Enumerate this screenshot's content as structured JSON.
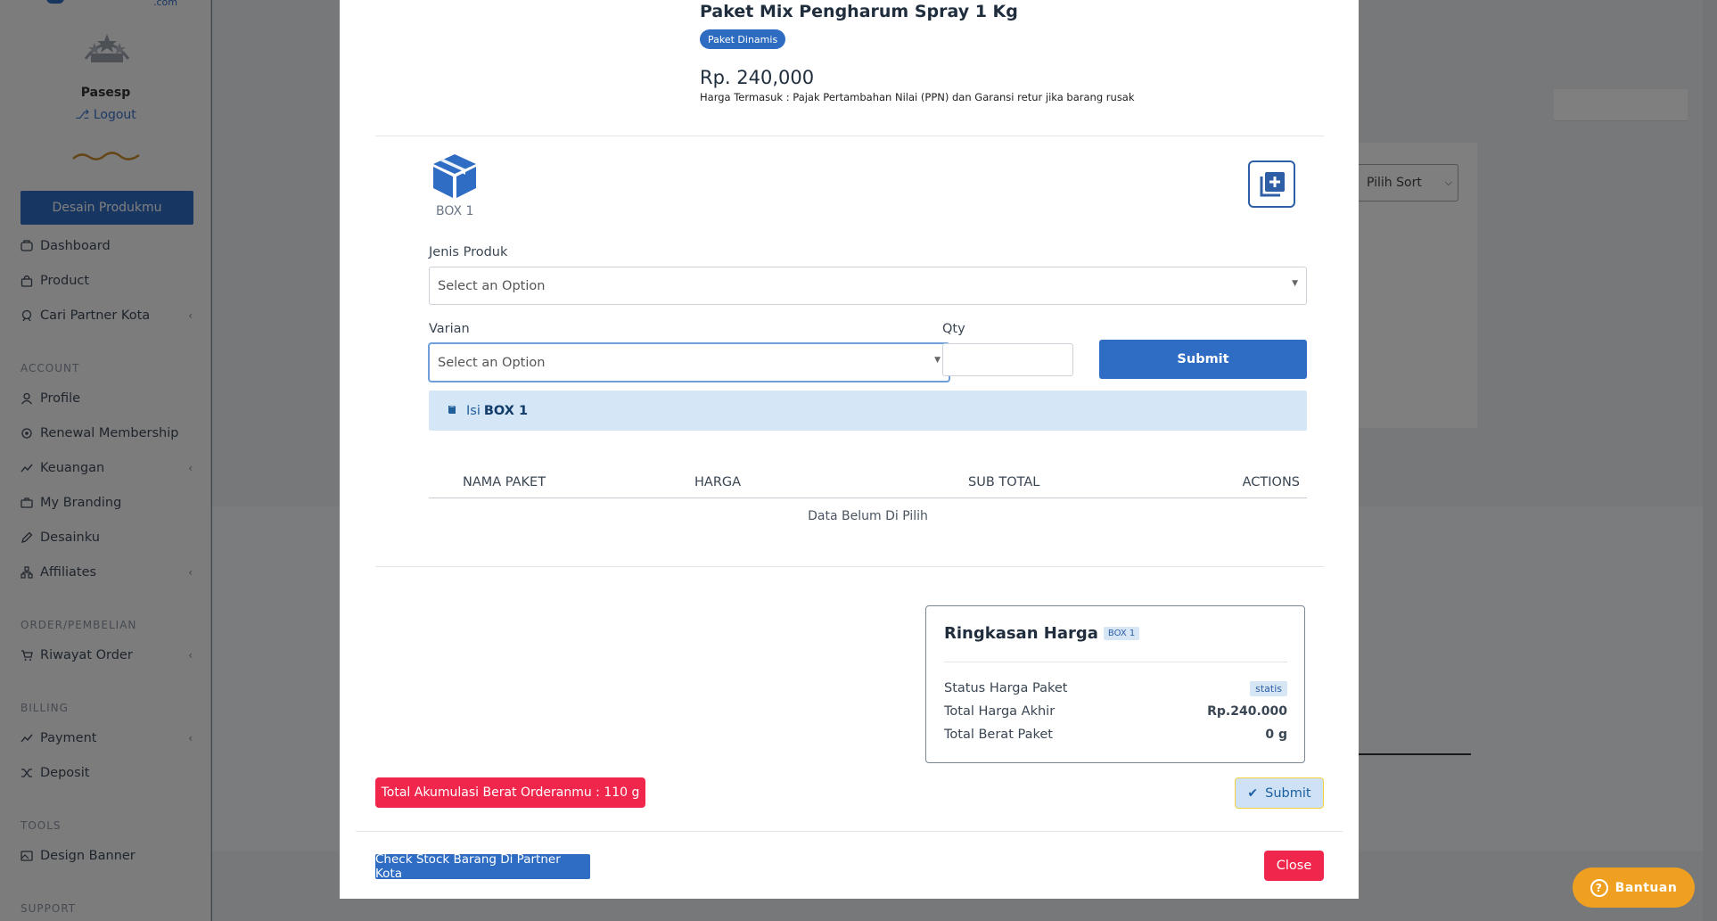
{
  "sidebar": {
    "logo_suffix": ".com",
    "user_name": "Pasesp",
    "logout_label": "Logout",
    "design_button": "Desain Produkmu",
    "items_main": [
      {
        "label": "Dashboard",
        "icon": "dashboard-icon"
      },
      {
        "label": "Product",
        "icon": "bag-icon"
      },
      {
        "label": "Cari Partner Kota",
        "icon": "search-partner-icon",
        "chevron": true
      }
    ],
    "account_heading": "ACCOUNT",
    "items_account": [
      {
        "label": "Profile",
        "icon": "user-icon"
      },
      {
        "label": "Renewal Membership",
        "icon": "refresh-icon"
      },
      {
        "label": "Keuangan",
        "icon": "chart-line-icon",
        "chevron": true
      },
      {
        "label": "My Branding",
        "icon": "briefcase-icon"
      },
      {
        "label": "Desainku",
        "icon": "pencil-icon"
      },
      {
        "label": "Affiliates",
        "icon": "network-icon",
        "chevron": true
      }
    ],
    "order_heading": "ORDER/PEMBELIAN",
    "items_order": [
      {
        "label": "Riwayat Order",
        "icon": "cart-icon",
        "chevron": true
      }
    ],
    "billing_heading": "BILLING",
    "items_billing": [
      {
        "label": "Payment",
        "icon": "chart-line-icon",
        "chevron": true
      },
      {
        "label": "Deposit",
        "icon": "shuffle-icon"
      }
    ],
    "tools_heading": "TOOLS",
    "items_tools": [
      {
        "label": "Design Banner",
        "icon": "image-icon"
      }
    ],
    "support_heading": "SUPPORT"
  },
  "background": {
    "sort_select": "Pilih Sort"
  },
  "modal": {
    "product_title": "Paket Mix Pengharum Spray 1 Kg",
    "type_badge": "Paket Dinamis",
    "price": "Rp. 240,000",
    "price_note": "Harga Termasuk : Pajak Pertambahan Nilai (PPN) dan Garansi retur jika barang rusak",
    "box_label": "BOX 1",
    "jenis_produk_label": "Jenis Produk",
    "jenis_produk_placeholder": "Select an Option",
    "varian_label": "Varian",
    "varian_placeholder": "Select an Option",
    "qty_label": "Qty",
    "qty_value": "",
    "submit_label": "Submit",
    "isi_prefix": "Isi",
    "isi_box": "BOX 1",
    "table": {
      "headers": [
        "NAMA PAKET",
        "HARGA",
        "SUB TOTAL",
        "ACTIONS"
      ],
      "empty_text": "Data Belum Di Pilih"
    },
    "summary": {
      "title": "Ringkasan Harga",
      "box_chip": "BOX 1",
      "status_label": "Status Harga Paket",
      "status_value": "statis",
      "total_label": "Total Harga Akhir",
      "total_value": "Rp.240.000",
      "weight_label": "Total Berat Paket",
      "weight_value": "0 g"
    },
    "weight_button": "Total Akumulasi Berat Orderanmu : 110 g",
    "submit_bottom": "Submit",
    "check_stock_button": "Check Stock Barang Di Partner Kota",
    "close_button": "Close"
  },
  "help_button": "Bantuan",
  "colors": {
    "primary": "#2f6cc4",
    "danger": "#f0264c",
    "help": "#f0a020"
  }
}
